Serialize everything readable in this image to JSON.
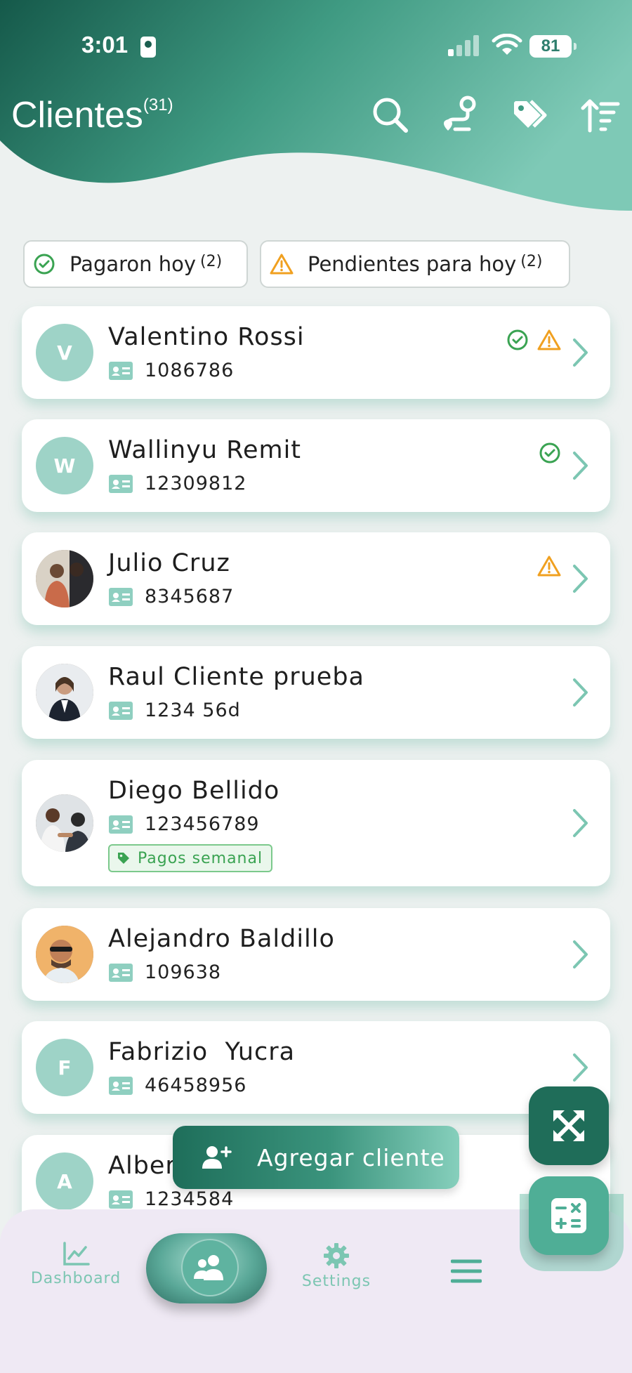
{
  "status_bar": {
    "time": "3:01",
    "battery": "81"
  },
  "header": {
    "title": "Clientes",
    "count": "(31)"
  },
  "filters": [
    {
      "label": "Pagaron hoy",
      "count": "(2)"
    },
    {
      "label": "Pendientes para hoy",
      "count": "(2)"
    }
  ],
  "clients": [
    {
      "initial": "V",
      "name": "Valentino Rossi",
      "id": "1086786"
    },
    {
      "initial": "W",
      "name": "Wallinyu Remit",
      "id": "12309812"
    },
    {
      "initial": "",
      "name": "Julio Cruz",
      "id": "8345687"
    },
    {
      "initial": "",
      "name": "Raul Cliente prueba",
      "id": "1234 56d"
    },
    {
      "initial": "",
      "name": "Diego Bellido",
      "id": "123456789",
      "tag": "Pagos semanal"
    },
    {
      "initial": "",
      "name": "Alejandro Baldillo",
      "id": "109638"
    },
    {
      "initial": "F",
      "name": "Fabrizio  Yucra",
      "id": "46458956"
    },
    {
      "initial": "A",
      "name": "Alber",
      "id": "1234584"
    }
  ],
  "actions": {
    "add_client": "Agregar cliente"
  },
  "nav": {
    "dashboard": "Dashboard",
    "settings": "Settings"
  },
  "colors": {
    "primary": "#1f6d59",
    "accent": "#7cc6b2",
    "paid": "#3aa352",
    "pending": "#f0a020"
  }
}
